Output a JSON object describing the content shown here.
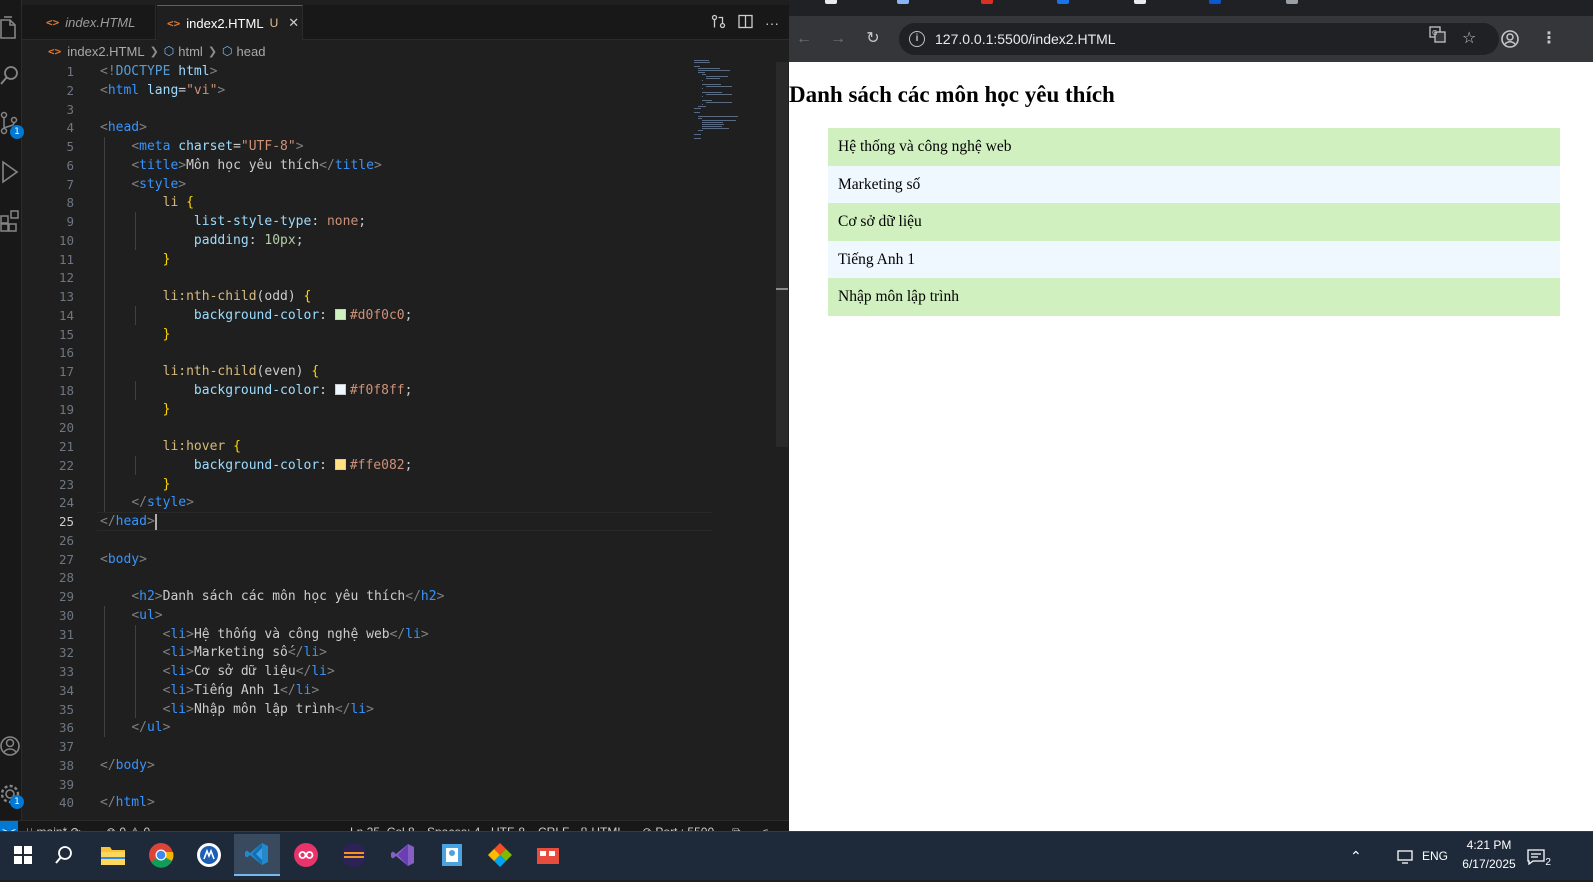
{
  "editor": {
    "tabs": [
      {
        "label": "index.HTML",
        "active": false
      },
      {
        "label": "index2.HTML",
        "active": true,
        "modified": "U"
      }
    ],
    "breadcrumb": [
      "index2.HTML",
      "html",
      "head"
    ],
    "activity_badges": {
      "source_control": "1",
      "settings": "1"
    },
    "lines": [
      {
        "n": "1",
        "html": "<span class='t-brk'>&lt;!</span><span class='t-dt'>DOCTYPE</span> <span class='t-attr'>html</span><span class='t-brk'>&gt;</span>"
      },
      {
        "n": "2",
        "html": "<span class='t-brk'>&lt;</span><span class='t-tag'>html</span> <span class='t-attr'>lang</span><span class='t-text'>=</span><span class='t-str'>\"vi\"</span><span class='t-brk'>&gt;</span>"
      },
      {
        "n": "3",
        "html": ""
      },
      {
        "n": "4",
        "html": "<span class='t-brk'>&lt;</span><span class='t-tag'>head</span><span class='t-brk'>&gt;</span>"
      },
      {
        "n": "5",
        "html": "    <span class='t-brk'>&lt;</span><span class='t-tag'>meta</span> <span class='t-attr'>charset</span><span class='t-text'>=</span><span class='t-str'>\"UTF-8\"</span><span class='t-brk'>&gt;</span>"
      },
      {
        "n": "6",
        "html": "    <span class='t-brk'>&lt;</span><span class='t-tag'>title</span><span class='t-brk'>&gt;</span><span class='t-text'>Môn học yêu thích</span><span class='t-brk'>&lt;/</span><span class='t-tag'>title</span><span class='t-brk'>&gt;</span>"
      },
      {
        "n": "7",
        "html": "    <span class='t-brk'>&lt;</span><span class='t-tag'>style</span><span class='t-brk'>&gt;</span>"
      },
      {
        "n": "8",
        "html": "        <span class='t-sel'>li</span> <span class='t-br'>{</span>"
      },
      {
        "n": "9",
        "html": "            <span class='t-prop'>list-style-type</span><span class='t-text'>: </span><span class='t-val'>none</span><span class='t-text'>;</span>"
      },
      {
        "n": "10",
        "html": "            <span class='t-prop'>padding</span><span class='t-text'>: </span><span class='t-num'>10px</span><span class='t-text'>;</span>"
      },
      {
        "n": "11",
        "html": "        <span class='t-br'>}</span>"
      },
      {
        "n": "12",
        "html": ""
      },
      {
        "n": "13",
        "html": "        <span class='t-sel'>li:nth-child</span><span class='t-text'>(odd)</span> <span class='t-br'>{</span>"
      },
      {
        "n": "14",
        "html": "            <span class='t-prop'>background-color</span><span class='t-text'>: </span><span class='swatch' style='background:#d0f0c0'></span><span class='t-val'>#d0f0c0</span><span class='t-text'>;</span>"
      },
      {
        "n": "15",
        "html": "        <span class='t-br'>}</span>"
      },
      {
        "n": "16",
        "html": ""
      },
      {
        "n": "17",
        "html": "        <span class='t-sel'>li:nth-child</span><span class='t-text'>(even)</span> <span class='t-br'>{</span>"
      },
      {
        "n": "18",
        "html": "            <span class='t-prop'>background-color</span><span class='t-text'>: </span><span class='swatch' style='background:#f0f8ff'></span><span class='t-val'>#f0f8ff</span><span class='t-text'>;</span>"
      },
      {
        "n": "19",
        "html": "        <span class='t-br'>}</span>"
      },
      {
        "n": "20",
        "html": ""
      },
      {
        "n": "21",
        "html": "        <span class='t-sel'>li:hover</span> <span class='t-br'>{</span>"
      },
      {
        "n": "22",
        "html": "            <span class='t-prop'>background-color</span><span class='t-text'>: </span><span class='swatch' style='background:#ffe082'></span><span class='t-val'>#ffe082</span><span class='t-text'>;</span>"
      },
      {
        "n": "23",
        "html": "        <span class='t-br'>}</span>"
      },
      {
        "n": "24",
        "html": "    <span class='t-brk'>&lt;/</span><span class='t-tag'>style</span><span class='t-brk'>&gt;</span>"
      },
      {
        "n": "25",
        "html": "<span class='t-brk'>&lt;/</span><span class='t-tag'>head</span><span class='t-brk'>&gt;</span><span class='caret'></span>"
      },
      {
        "n": "26",
        "html": ""
      },
      {
        "n": "27",
        "html": "<span class='t-brk'>&lt;</span><span class='t-tag'>body</span><span class='t-brk'>&gt;</span>"
      },
      {
        "n": "28",
        "html": ""
      },
      {
        "n": "29",
        "html": "    <span class='t-brk'>&lt;</span><span class='t-tag'>h2</span><span class='t-brk'>&gt;</span><span class='t-text'>Danh sách các môn học yêu thích</span><span class='t-brk'>&lt;/</span><span class='t-tag'>h2</span><span class='t-brk'>&gt;</span>"
      },
      {
        "n": "30",
        "html": "    <span class='t-brk'>&lt;</span><span class='t-tag'>ul</span><span class='t-brk'>&gt;</span>"
      },
      {
        "n": "31",
        "html": "        <span class='t-brk'>&lt;</span><span class='t-tag'>li</span><span class='t-brk'>&gt;</span><span class='t-text'>Hệ thống và công nghệ web</span><span class='t-brk'>&lt;/</span><span class='t-tag'>li</span><span class='t-brk'>&gt;</span>"
      },
      {
        "n": "32",
        "html": "        <span class='t-brk'>&lt;</span><span class='t-tag'>li</span><span class='t-brk'>&gt;</span><span class='t-text'>Marketing số</span><span class='t-brk'>&lt;/</span><span class='t-tag'>li</span><span class='t-brk'>&gt;</span>"
      },
      {
        "n": "33",
        "html": "        <span class='t-brk'>&lt;</span><span class='t-tag'>li</span><span class='t-brk'>&gt;</span><span class='t-text'>Cơ sở dữ liệu</span><span class='t-brk'>&lt;/</span><span class='t-tag'>li</span><span class='t-brk'>&gt;</span>"
      },
      {
        "n": "34",
        "html": "        <span class='t-brk'>&lt;</span><span class='t-tag'>li</span><span class='t-brk'>&gt;</span><span class='t-text'>Tiếng Anh 1</span><span class='t-brk'>&lt;/</span><span class='t-tag'>li</span><span class='t-brk'>&gt;</span>"
      },
      {
        "n": "35",
        "html": "        <span class='t-brk'>&lt;</span><span class='t-tag'>li</span><span class='t-brk'>&gt;</span><span class='t-text'>Nhập môn lập trình</span><span class='t-brk'>&lt;/</span><span class='t-tag'>li</span><span class='t-brk'>&gt;</span>"
      },
      {
        "n": "36",
        "html": "    <span class='t-brk'>&lt;/</span><span class='t-tag'>ul</span><span class='t-brk'>&gt;</span>"
      },
      {
        "n": "37",
        "html": ""
      },
      {
        "n": "38",
        "html": "<span class='t-brk'>&lt;/</span><span class='t-tag'>body</span><span class='t-brk'>&gt;</span>"
      },
      {
        "n": "39",
        "html": ""
      },
      {
        "n": "40",
        "html": "<span class='t-brk'>&lt;/</span><span class='t-tag'>html</span><span class='t-brk'>&gt;</span>"
      }
    ],
    "current_line": "25",
    "status": {
      "branch": "main*",
      "problems": "0",
      "warnings": "0",
      "position": "Ln 25, Col 8",
      "spaces": "Spaces: 4",
      "encoding": "UTF-8",
      "eol": "CRLF",
      "language": "HTML",
      "port": "Port : 5500"
    }
  },
  "browser": {
    "url": "127.0.0.1:5500/index2.HTML",
    "page": {
      "heading": "Danh sách các môn học yêu thích",
      "items": [
        "Hệ thống và công nghệ web",
        "Marketing số",
        "Cơ sở dữ liệu",
        "Tiếng Anh 1",
        "Nhập môn lập trình"
      ],
      "odd_color": "#d0f0c0",
      "even_color": "#f0f8ff"
    }
  },
  "taskbar": {
    "language": "ENG",
    "time": "4:21 PM",
    "date": "6/17/2025",
    "notifications": "2"
  }
}
